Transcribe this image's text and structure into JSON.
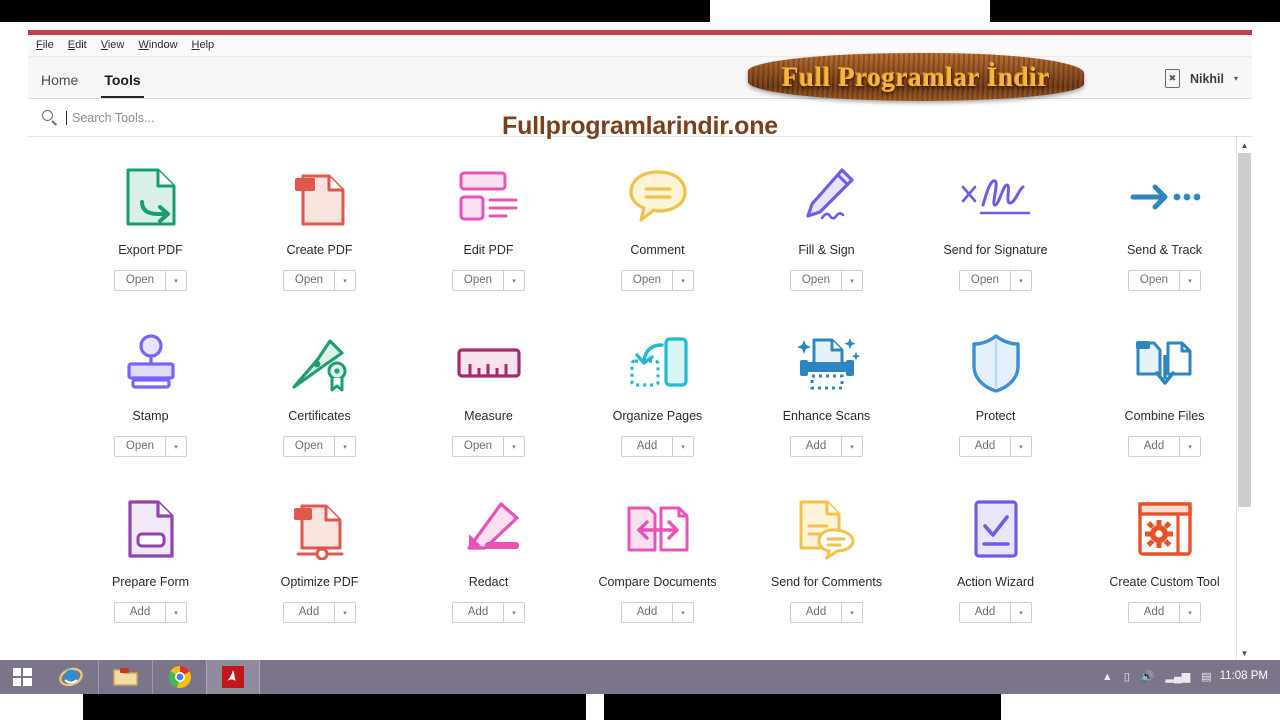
{
  "window": {
    "menubar": [
      {
        "label": "File",
        "accel": "F"
      },
      {
        "label": "Edit",
        "accel": "E"
      },
      {
        "label": "View",
        "accel": "V"
      },
      {
        "label": "Window",
        "accel": "W"
      },
      {
        "label": "Help",
        "accel": "H"
      }
    ],
    "accent_color": "#c2414f"
  },
  "tabs": [
    {
      "label": "Home",
      "active": false
    },
    {
      "label": "Tools",
      "active": true
    }
  ],
  "account": {
    "device_icon": "mobile-device-icon",
    "user_name": "Nikhil",
    "caret": "▾"
  },
  "search": {
    "icon": "search-icon",
    "placeholder": "Search Tools...",
    "value": ""
  },
  "tools": [
    {
      "label": "Export PDF",
      "button": "Open",
      "icon": "export-pdf-icon",
      "color": "#21a179"
    },
    {
      "label": "Create PDF",
      "button": "Open",
      "icon": "create-pdf-icon",
      "color": "#e2574c"
    },
    {
      "label": "Edit PDF",
      "button": "Open",
      "icon": "edit-pdf-icon",
      "color": "#e754b5"
    },
    {
      "label": "Comment",
      "button": "Open",
      "icon": "comment-icon",
      "color": "#f2c14b"
    },
    {
      "label": "Fill & Sign",
      "button": "Open",
      "icon": "fill-and-sign-icon",
      "color": "#6c5ce7"
    },
    {
      "label": "Send for Signature",
      "button": "Open",
      "icon": "send-for-signature-icon",
      "color": "#6c5ce7"
    },
    {
      "label": "Send & Track",
      "button": "Open",
      "icon": "send-and-track-icon",
      "color": "#2e86c1"
    },
    {
      "label": "Stamp",
      "button": "Open",
      "icon": "stamp-icon",
      "color": "#7b61ff"
    },
    {
      "label": "Certificates",
      "button": "Open",
      "icon": "certificates-icon",
      "color": "#1e9e6a"
    },
    {
      "label": "Measure",
      "button": "Open",
      "icon": "measure-icon",
      "color": "#a32b6d"
    },
    {
      "label": "Organize Pages",
      "button": "Add",
      "icon": "organize-pages-icon",
      "color": "#22b8cf"
    },
    {
      "label": "Enhance Scans",
      "button": "Add",
      "icon": "enhance-scans-icon",
      "color": "#2e86c1"
    },
    {
      "label": "Protect",
      "button": "Add",
      "icon": "protect-shield-icon",
      "color": "#3b8fd4"
    },
    {
      "label": "Combine Files",
      "button": "Add",
      "icon": "combine-files-icon",
      "color": "#2e86c1"
    },
    {
      "label": "Prepare Form",
      "button": "Add",
      "icon": "prepare-form-icon",
      "color": "#8e44ad"
    },
    {
      "label": "Optimize PDF",
      "button": "Add",
      "icon": "optimize-pdf-icon",
      "color": "#e2574c"
    },
    {
      "label": "Redact",
      "button": "Add",
      "icon": "redact-icon",
      "color": "#e754b5"
    },
    {
      "label": "Compare Documents",
      "button": "Add",
      "icon": "compare-documents-icon",
      "color": "#e754b5"
    },
    {
      "label": "Send for Comments",
      "button": "Add",
      "icon": "send-for-comments-icon",
      "color": "#f2c14b"
    },
    {
      "label": "Action Wizard",
      "button": "Add",
      "icon": "action-wizard-icon",
      "color": "#6c5ce7"
    },
    {
      "label": "Create Custom Tool",
      "button": "Add",
      "icon": "create-custom-tool-icon",
      "color": "#e8522a"
    }
  ],
  "button_dropdown_caret": "▾",
  "scrollbar": {
    "up": "▲",
    "down": "▼",
    "thumb_percent": 72
  },
  "watermarks": {
    "banner_text": "Full Programlar İndir",
    "url_text": "Fullprogramlarindir.one"
  },
  "taskbar": {
    "start_icon": "windows-start-icon",
    "items": [
      {
        "icon": "internet-explorer-icon"
      },
      {
        "icon": "file-explorer-icon"
      },
      {
        "icon": "google-chrome-icon"
      },
      {
        "icon": "acrobat-reader-icon"
      }
    ],
    "tray": [
      "▲",
      "battery-icon",
      "volume-icon",
      "network-icon",
      "action-center-icon"
    ],
    "clock": "11:08 PM"
  }
}
